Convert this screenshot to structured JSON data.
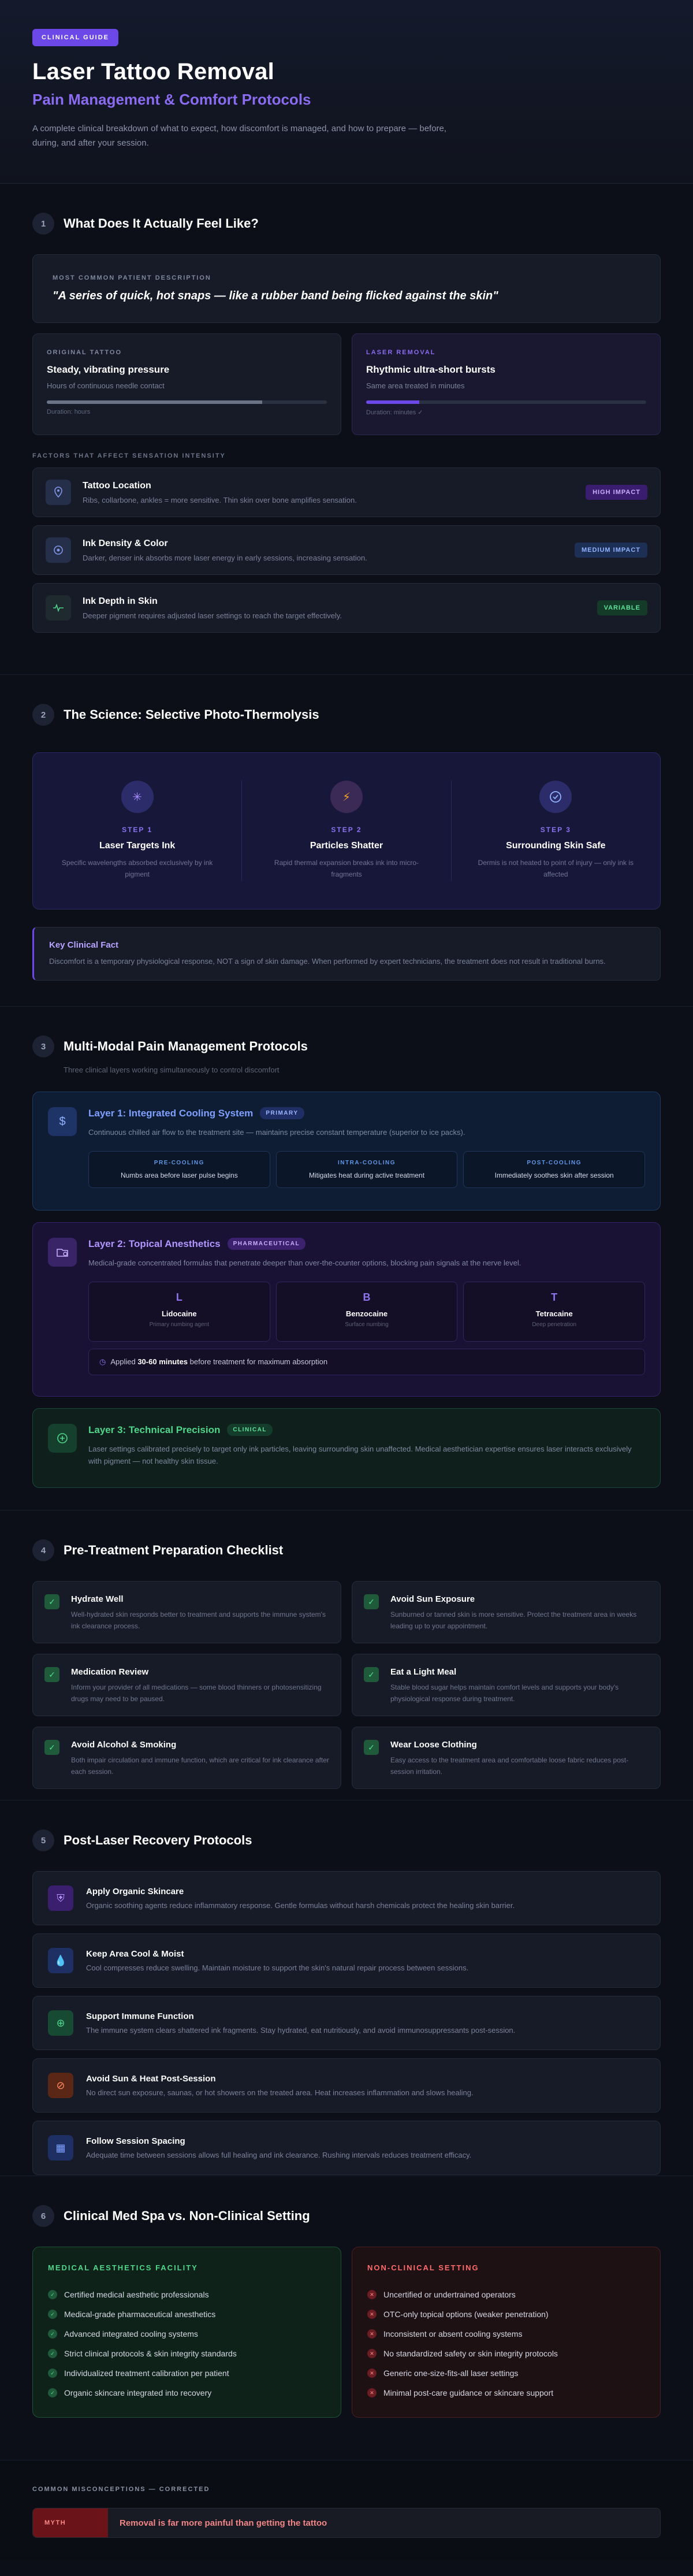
{
  "hero": {
    "badge": "CLINICAL GUIDE",
    "title": "Laser Tattoo Removal",
    "subtitle": "Pain Management & Comfort Protocols",
    "description": "A complete clinical breakdown of what to expect, how discomfort is managed, and how to prepare — before, during, and after your session."
  },
  "s1": {
    "num": "1",
    "title": "What Does It Actually Feel Like?",
    "quote_label": "MOST COMMON PATIENT DESCRIPTION",
    "quote": "\"A series of quick, hot snaps — like a rubber band being flicked against the skin\"",
    "original": {
      "label": "ORIGINAL TATTOO",
      "title": "Steady, vibrating pressure",
      "desc": "Hours of continuous needle contact",
      "caption": "Duration: hours",
      "fill": 0.77
    },
    "laser": {
      "label": "LASER REMOVAL",
      "title": "Rhythmic ultra-short bursts",
      "desc": "Same area treated in minutes",
      "caption": "Duration: minutes ✓",
      "fill": 0.19
    },
    "factors_label": "FACTORS THAT AFFECT SENSATION INTENSITY",
    "factors": [
      {
        "title": "Tattoo Location",
        "desc": "Ribs, collarbone, ankles = more sensitive. Thin skin over bone amplifies sensation.",
        "badge": "HIGH IMPACT",
        "icon": "location-pin-icon"
      },
      {
        "title": "Ink Density & Color",
        "desc": "Darker, denser ink absorbs more laser energy in early sessions, increasing sensation.",
        "badge": "MEDIUM IMPACT",
        "icon": "target-icon"
      },
      {
        "title": "Ink Depth in Skin",
        "desc": "Deeper pigment requires adjusted laser settings to reach the target effectively.",
        "badge": "VARIABLE",
        "icon": "pulse-icon"
      }
    ]
  },
  "s2": {
    "num": "2",
    "title": "The Science: Selective Photo-Thermolysis",
    "steps": [
      {
        "step": "STEP 1",
        "title": "Laser Targets Ink",
        "desc": "Specific wavelengths absorbed exclusively by ink pigment",
        "icon": "sparkle-icon"
      },
      {
        "step": "STEP 2",
        "title": "Particles Shatter",
        "desc": "Rapid thermal expansion breaks ink into micro-fragments",
        "icon": "lightning-icon"
      },
      {
        "step": "STEP 3",
        "title": "Surrounding Skin Safe",
        "desc": "Dermis is not heated to point of injury — only ink is affected",
        "icon": "check-circle-icon"
      }
    ],
    "fact_title": "Key Clinical Fact",
    "fact_text": "Discomfort is a temporary physiological response, NOT a sign of skin damage. When performed by expert technicians, the treatment does not result in traditional burns."
  },
  "s3": {
    "num": "3",
    "title": "Multi-Modal Pain Management Protocols",
    "subtitle": "Three clinical layers working simultaneously to control discomfort",
    "l1": {
      "title": "Layer 1: Integrated Cooling System",
      "tag": "PRIMARY",
      "desc": "Continuous chilled air flow to the treatment site — maintains precise constant temperature (superior to ice packs).",
      "items": [
        {
          "t": "PRE-COOLING",
          "v": "Numbs area before laser pulse begins"
        },
        {
          "t": "INTRA-COOLING",
          "v": "Mitigates heat during active treatment"
        },
        {
          "t": "POST-COOLING",
          "v": "Immediately soothes skin after session"
        }
      ]
    },
    "l2": {
      "title": "Layer 2: Topical Anesthetics",
      "tag": "PHARMACEUTICAL",
      "desc": "Medical-grade concentrated formulas that penetrate deeper than over-the-counter options, blocking pain signals at the nerve level.",
      "items": [
        {
          "L": "L",
          "n": "Lidocaine",
          "c": "Primary numbing agent"
        },
        {
          "L": "B",
          "n": "Benzocaine",
          "c": "Surface numbing"
        },
        {
          "L": "T",
          "n": "Tetracaine",
          "c": "Deep penetration"
        }
      ],
      "apply_pre": "Applied ",
      "apply_bold": "30-60 minutes",
      "apply_post": " before treatment for maximum absorption"
    },
    "l3": {
      "title": "Layer 3: Technical Precision",
      "tag": "CLINICAL",
      "desc": "Laser settings calibrated precisely to target only ink particles, leaving surrounding skin unaffected. Medical aesthetician expertise ensures laser interacts exclusively with pigment — not healthy skin tissue."
    }
  },
  "s4": {
    "num": "4",
    "title": "Pre-Treatment Preparation Checklist",
    "items": [
      {
        "t": "Hydrate Well",
        "d": "Well-hydrated skin responds better to treatment and supports the immune system's ink clearance process."
      },
      {
        "t": "Avoid Sun Exposure",
        "d": "Sunburned or tanned skin is more sensitive. Protect the treatment area in weeks leading up to your appointment."
      },
      {
        "t": "Medication Review",
        "d": "Inform your provider of all medications — some blood thinners or photosensitizing drugs may need to be paused."
      },
      {
        "t": "Eat a Light Meal",
        "d": "Stable blood sugar helps maintain comfort levels and supports your body's physiological response during treatment."
      },
      {
        "t": "Avoid Alcohol & Smoking",
        "d": "Both impair circulation and immune function, which are critical for ink clearance after each session."
      },
      {
        "t": "Wear Loose Clothing",
        "d": "Easy access to the treatment area and comfortable loose fabric reduces post-session irritation."
      }
    ]
  },
  "s5": {
    "num": "5",
    "title": "Post-Laser Recovery Protocols",
    "items": [
      {
        "t": "Apply Organic Skincare",
        "d": "Organic soothing agents reduce inflammatory response. Gentle formulas without harsh chemicals protect the healing skin barrier.",
        "icon": "shield-icon",
        "bg": "#3a1f6e",
        "fg": "#b995ff"
      },
      {
        "t": "Keep Area Cool & Moist",
        "d": "Cool compresses reduce swelling. Maintain moisture to support the skin's natural repair process between sessions.",
        "icon": "droplet-icon",
        "bg": "#1e2f63",
        "fg": "#7ea0ff"
      },
      {
        "t": "Support Immune Function",
        "d": "The immune system clears shattered ink fragments. Stay hydrated, eat nutritiously, and avoid immunosuppressants post-session.",
        "icon": "plus-circle-icon",
        "bg": "#174a33",
        "fg": "#4fd68b"
      },
      {
        "t": "Avoid Sun & Heat Post-Session",
        "d": "No direct sun exposure, saunas, or hot showers on the treated area. Heat increases inflammation and slows healing.",
        "icon": "no-sun-icon",
        "bg": "#5a2616",
        "fg": "#ff8a5c"
      },
      {
        "t": "Follow Session Spacing",
        "d": "Adequate time between sessions allows full healing and ink clearance. Rushing intervals reduces treatment efficacy.",
        "icon": "calendar-icon",
        "bg": "#1e2f63",
        "fg": "#7ea0ff"
      }
    ]
  },
  "s6": {
    "num": "6",
    "title": "Clinical Med Spa vs. Non-Clinical Setting",
    "med_title": "MEDICAL AESTHETICS FACILITY",
    "med": [
      "Certified medical aesthetic professionals",
      "Medical-grade pharmaceutical anesthetics",
      "Advanced integrated cooling systems",
      "Strict clinical protocols & skin integrity standards",
      "Individualized treatment calibration per patient",
      "Organic skincare integrated into recovery"
    ],
    "non_title": "NON-CLINICAL SETTING",
    "non": [
      "Uncertified or undertrained operators",
      "OTC-only topical options (weaker penetration)",
      "Inconsistent or absent cooling systems",
      "No standardized safety or skin integrity protocols",
      "Generic one-size-fits-all laser settings",
      "Minimal post-care guidance or skincare support"
    ]
  },
  "myths": {
    "label": "COMMON MISCONCEPTIONS — CORRECTED",
    "items": [
      {
        "tag": "MYTH",
        "text": "Removal is far more painful than getting the tattoo"
      }
    ]
  },
  "colors": {
    "accent": "#6c48e8",
    "accent_text": "#8b6bf0",
    "success": "#4fd68b",
    "danger": "#ff6b6b"
  }
}
